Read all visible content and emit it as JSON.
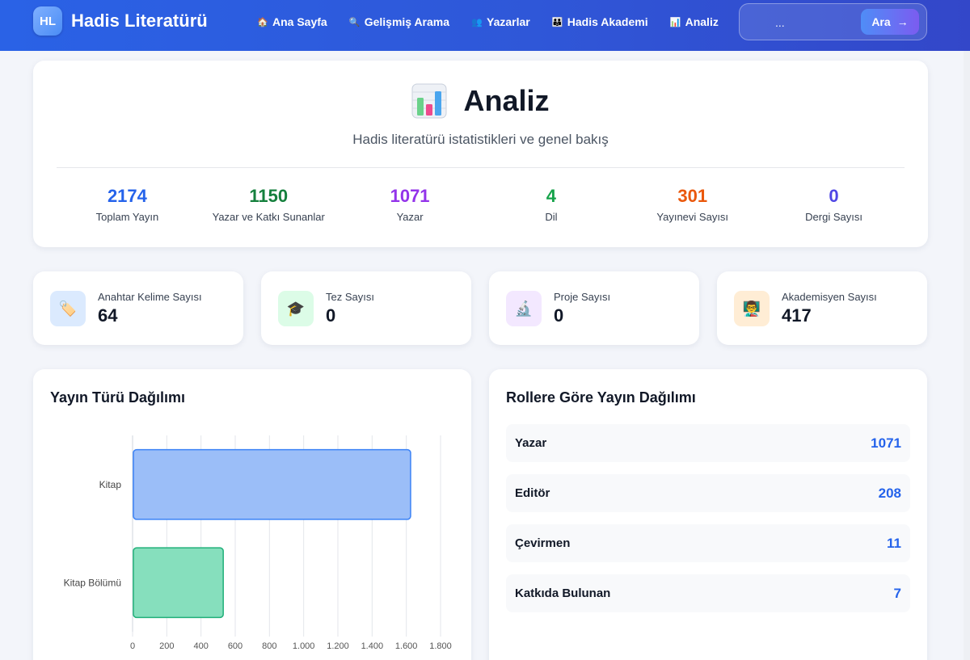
{
  "brand": {
    "logo": "HL",
    "name": "Hadis Literatürü"
  },
  "nav": [
    {
      "label": "Ana Sayfa",
      "icon": "house-icon",
      "glyph": "🏠"
    },
    {
      "label": "Gelişmiş Arama",
      "icon": "search-icon",
      "glyph": "🔍"
    },
    {
      "label": "Yazarlar",
      "icon": "people-icon",
      "glyph": "👥"
    },
    {
      "label": "Hadis Akademi",
      "icon": "academy-icon",
      "glyph": "👪"
    },
    {
      "label": "Analiz",
      "icon": "bar-chart-icon",
      "glyph": "📊"
    }
  ],
  "search": {
    "placeholder": "...",
    "button_label": "Ara",
    "button_arrow": "→"
  },
  "hero": {
    "title": "Analiz",
    "subtitle": "Hadis literatürü istatistikleri ve genel bakış",
    "stats": [
      {
        "value": "2174",
        "label": "Toplam Yayın",
        "color": "#2563eb"
      },
      {
        "value": "1150",
        "label": "Yazar ve Katkı Sunanlar",
        "color": "#15803d"
      },
      {
        "value": "1071",
        "label": "Yazar",
        "color": "#9333ea"
      },
      {
        "value": "4",
        "label": "Dil",
        "color": "#16a34a"
      },
      {
        "value": "301",
        "label": "Yayınevi Sayısı",
        "color": "#ea580c"
      },
      {
        "value": "0",
        "label": "Dergi Sayısı",
        "color": "#4f46e5"
      }
    ]
  },
  "mini_cards": [
    {
      "label": "Anahtar Kelime Sayısı",
      "value": "64",
      "icon": "tag-icon",
      "glyph": "🏷️",
      "bg": "#dbeafe"
    },
    {
      "label": "Tez Sayısı",
      "value": "0",
      "icon": "graduation-cap-icon",
      "glyph": "🎓",
      "bg": "#dcfce7"
    },
    {
      "label": "Proje Sayısı",
      "value": "0",
      "icon": "microscope-icon",
      "glyph": "🔬",
      "bg": "#f3e8ff"
    },
    {
      "label": "Akademisyen Sayısı",
      "value": "417",
      "icon": "teacher-icon",
      "glyph": "👨‍🏫",
      "bg": "#ffedd5"
    }
  ],
  "publication_chart": {
    "title": "Yayın Türü Dağılımı"
  },
  "chart_data": {
    "type": "bar",
    "orientation": "horizontal",
    "categories": [
      "Kitap",
      "Kitap Bölümü"
    ],
    "values": [
      1625,
      530
    ],
    "xlim": [
      0,
      1800
    ],
    "xticks": [
      "0",
      "200",
      "400",
      "600",
      "800",
      "1.000",
      "1.200",
      "1.400",
      "1.600",
      "1.800"
    ],
    "grid": true,
    "colors": [
      "#9bbef8",
      "#86dfbd"
    ],
    "borders": [
      "#3b82f6",
      "#22b07a"
    ]
  },
  "roles": {
    "title": "Rollere Göre Yayın Dağılımı",
    "items": [
      {
        "name": "Yazar",
        "count": "1071"
      },
      {
        "name": "Editör",
        "count": "208"
      },
      {
        "name": "Çevirmen",
        "count": "11"
      },
      {
        "name": "Katkıda Bulunan",
        "count": "7"
      }
    ]
  }
}
